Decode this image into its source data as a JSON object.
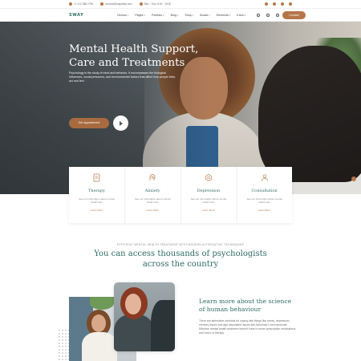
{
  "topbar": {
    "phone": "+1 212 386 2796",
    "email": "contact@wayshelp.com",
    "hours": "Mon - Sun: 8:00 - 18:00"
  },
  "brand": {
    "logo": "SWAY"
  },
  "nav": {
    "items": [
      {
        "label": "Demos"
      },
      {
        "label": "Pages"
      },
      {
        "label": "Portfolio"
      },
      {
        "label": "Blog"
      },
      {
        "label": "Shop"
      },
      {
        "label": "Books"
      },
      {
        "label": "Elements"
      },
      {
        "label": "Extra"
      }
    ],
    "contact_label": "Contact Us"
  },
  "hero": {
    "title_line1": "Mental Health Support,",
    "title_line2": "Care and Treatments",
    "description": "Psychology is the study of mind and behavior. It encompasses the biological influences, social pressures, and environmental factors that affect how people think, act and feel.",
    "cta_label": "Get Appointment"
  },
  "services": [
    {
      "title": "Therapy",
      "desc": "See our information about mental health care",
      "more": "Learn More",
      "icon": "therapy-icon"
    },
    {
      "title": "Anxiety",
      "desc": "See our information about mental health care",
      "more": "Learn More",
      "icon": "anxiety-icon"
    },
    {
      "title": "Depression",
      "desc": "See our information about mental health care",
      "more": "Learn More",
      "icon": "depression-icon"
    },
    {
      "title": "Consultation",
      "desc": "See our information about mental health care",
      "more": "Learn More",
      "icon": "consultation-icon"
    }
  ],
  "section": {
    "eyebrow": "EFFICIENT MENTAL HEALTH TREATMENT WITH MODERN ALTERNATIVE TECHNIQUES",
    "title_line1": "You can access thousands of psychologists",
    "title_line2": "across the country"
  },
  "about": {
    "title_line1": "Learn more about the science",
    "title_line2": "of human behaviour",
    "text": "There are alternative methods for coping with things like stress, depression, memory issues and age associated issues like Alzheimer's and dementia. Effective mental health treatment doesn't have to mean prescription medications and hours of therapy."
  },
  "colors": {
    "accent": "#b5764a",
    "heading": "#2e6b63"
  }
}
